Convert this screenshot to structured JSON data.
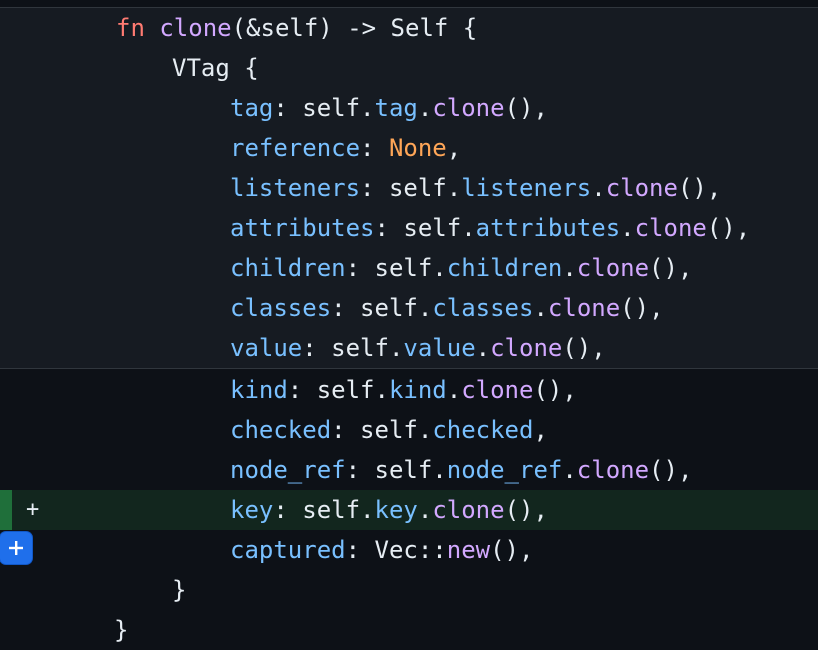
{
  "colors": {
    "background": "#0d1117",
    "context_row": "#161b22",
    "added_row": "#12261e",
    "added_bar": "#1f6f3a",
    "keyword": "#ff7b72",
    "function": "#d2a8ff",
    "field": "#79c0ff",
    "constant": "#ffa657",
    "text": "#e6edf3",
    "add_button": "#1f6feb"
  },
  "icons": {
    "add_comment": "plus-icon"
  },
  "diff": {
    "added_marker": "+",
    "lines": [
      {
        "type": "context",
        "tokens": [
          {
            "t": "fn",
            "k": "kw"
          },
          {
            "t": " "
          },
          {
            "t": "clone",
            "k": "fnc"
          },
          {
            "t": "(&self) -> Self {"
          }
        ]
      },
      {
        "type": "context",
        "tokens": [
          {
            "t": "VTag {"
          }
        ]
      },
      {
        "type": "context",
        "tokens": [
          {
            "t": "tag",
            "k": "fld"
          },
          {
            "t": ": self."
          },
          {
            "t": "tag",
            "k": "fld"
          },
          {
            "t": "."
          },
          {
            "t": "clone",
            "k": "fnc"
          },
          {
            "t": "(),"
          }
        ]
      },
      {
        "type": "context",
        "tokens": [
          {
            "t": "reference",
            "k": "fld"
          },
          {
            "t": ": "
          },
          {
            "t": "None",
            "k": "cst"
          },
          {
            "t": ","
          }
        ]
      },
      {
        "type": "context",
        "tokens": [
          {
            "t": "listeners",
            "k": "fld"
          },
          {
            "t": ": self."
          },
          {
            "t": "listeners",
            "k": "fld"
          },
          {
            "t": "."
          },
          {
            "t": "clone",
            "k": "fnc"
          },
          {
            "t": "(),"
          }
        ]
      },
      {
        "type": "context",
        "tokens": [
          {
            "t": "attributes",
            "k": "fld"
          },
          {
            "t": ": self."
          },
          {
            "t": "attributes",
            "k": "fld"
          },
          {
            "t": "."
          },
          {
            "t": "clone",
            "k": "fnc"
          },
          {
            "t": "(),"
          }
        ]
      },
      {
        "type": "context",
        "tokens": [
          {
            "t": "children",
            "k": "fld"
          },
          {
            "t": ": self."
          },
          {
            "t": "children",
            "k": "fld"
          },
          {
            "t": "."
          },
          {
            "t": "clone",
            "k": "fnc"
          },
          {
            "t": "(),"
          }
        ]
      },
      {
        "type": "context",
        "tokens": [
          {
            "t": "classes",
            "k": "fld"
          },
          {
            "t": ": self."
          },
          {
            "t": "classes",
            "k": "fld"
          },
          {
            "t": "."
          },
          {
            "t": "clone",
            "k": "fnc"
          },
          {
            "t": "(),"
          }
        ]
      },
      {
        "type": "context",
        "tokens": [
          {
            "t": "value",
            "k": "fld"
          },
          {
            "t": ": self."
          },
          {
            "t": "value",
            "k": "fld"
          },
          {
            "t": "."
          },
          {
            "t": "clone",
            "k": "fnc"
          },
          {
            "t": "(),"
          }
        ]
      },
      {
        "type": "plain",
        "tokens": [
          {
            "t": "kind",
            "k": "fld"
          },
          {
            "t": ": self."
          },
          {
            "t": "kind",
            "k": "fld"
          },
          {
            "t": "."
          },
          {
            "t": "clone",
            "k": "fnc"
          },
          {
            "t": "(),"
          }
        ]
      },
      {
        "type": "plain",
        "tokens": [
          {
            "t": "checked",
            "k": "fld"
          },
          {
            "t": ": self."
          },
          {
            "t": "checked",
            "k": "fld"
          },
          {
            "t": ","
          }
        ]
      },
      {
        "type": "plain",
        "tokens": [
          {
            "t": "node_ref",
            "k": "fld"
          },
          {
            "t": ": self."
          },
          {
            "t": "node_ref",
            "k": "fld"
          },
          {
            "t": "."
          },
          {
            "t": "clone",
            "k": "fnc"
          },
          {
            "t": "(),"
          }
        ]
      },
      {
        "type": "added",
        "tokens": [
          {
            "t": "key",
            "k": "fld"
          },
          {
            "t": ": self."
          },
          {
            "t": "key",
            "k": "fld"
          },
          {
            "t": "."
          },
          {
            "t": "clone",
            "k": "fnc"
          },
          {
            "t": "(),"
          }
        ]
      },
      {
        "type": "plain",
        "tokens": [
          {
            "t": "captured",
            "k": "fld"
          },
          {
            "t": ": Vec::"
          },
          {
            "t": "new",
            "k": "fnc"
          },
          {
            "t": "(),"
          }
        ]
      },
      {
        "type": "plain",
        "tokens": [
          {
            "t": "}"
          }
        ]
      },
      {
        "type": "plain",
        "tokens": [
          {
            "t": "}"
          }
        ]
      }
    ]
  }
}
